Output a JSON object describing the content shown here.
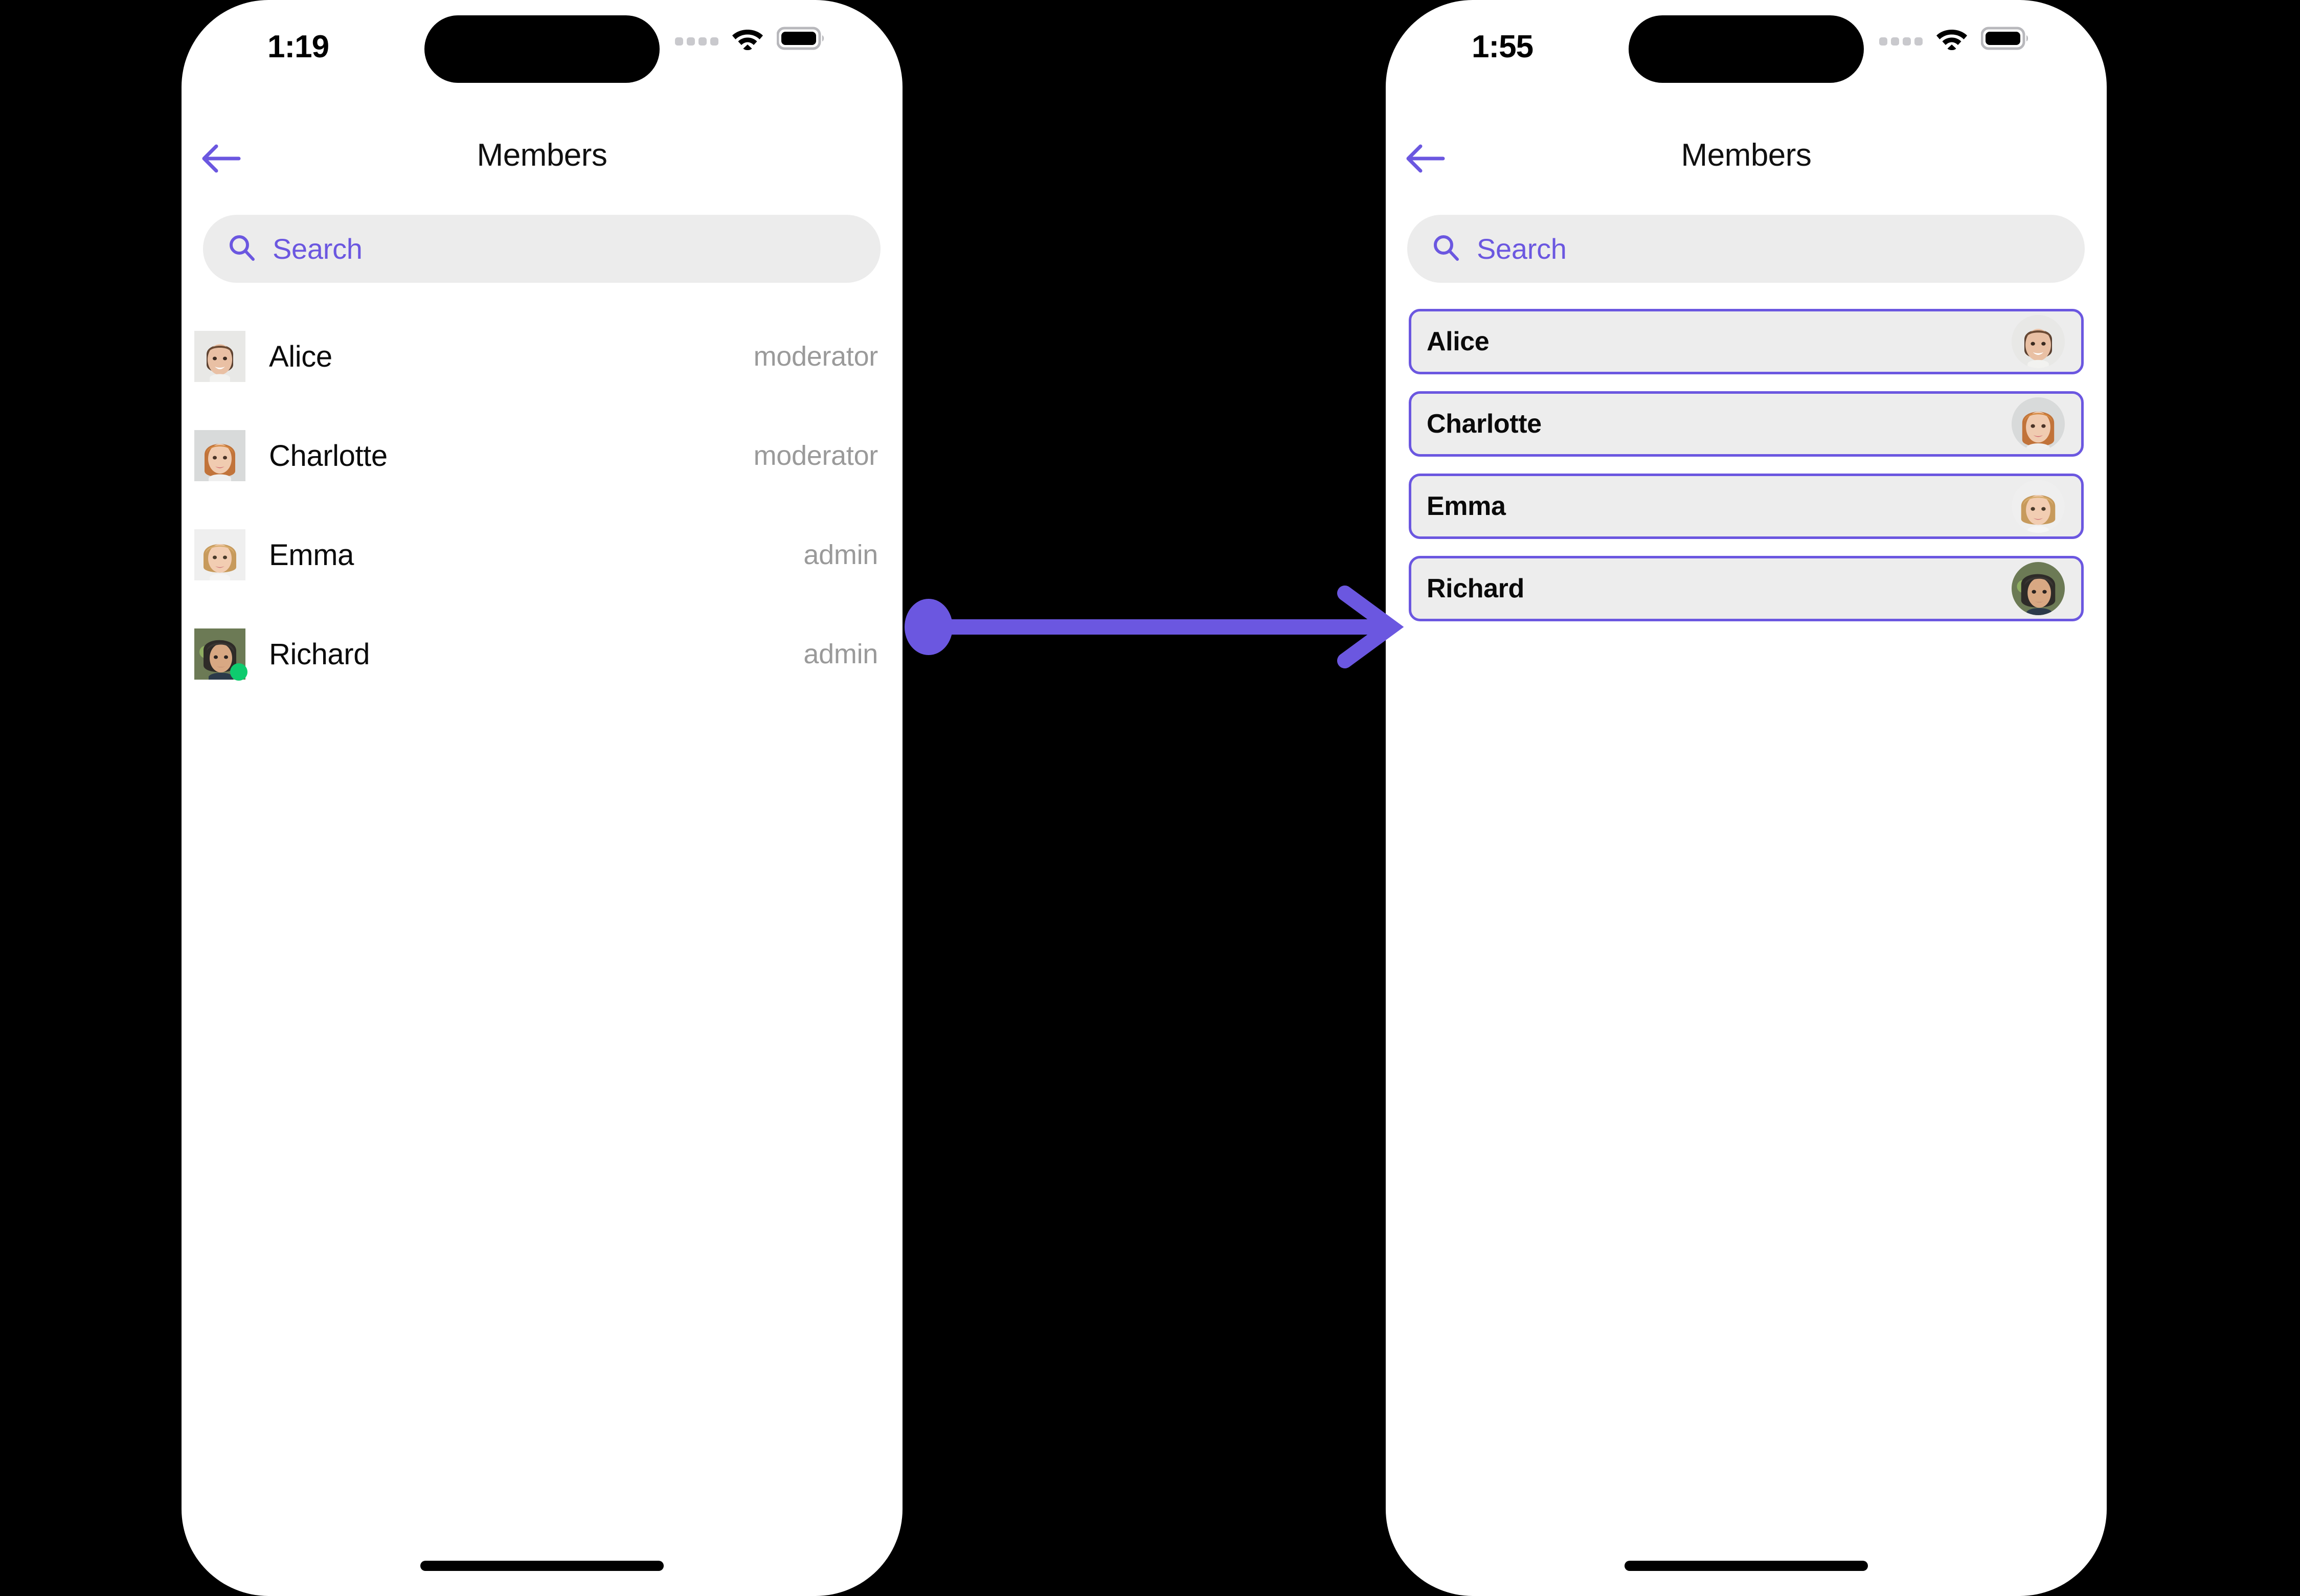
{
  "theme": {
    "accent": "#6b57e0",
    "card_fill": "#ededed",
    "search_fill": "#ececec",
    "role_text": "#9a9a9a",
    "online_badge": "#0ecb6e",
    "backdrop": "#000000"
  },
  "screens": [
    {
      "id": "members-list",
      "status_bar": {
        "time": "1:19",
        "cellular_icon": "cellular-bars-icon",
        "wifi_icon": "wifi-icon",
        "battery_icon": "battery-full-icon"
      },
      "nav": {
        "back_icon": "arrow-left-icon",
        "title": "Members"
      },
      "search": {
        "icon": "search-icon",
        "placeholder": "Search",
        "value": ""
      },
      "members": [
        {
          "name": "Alice",
          "role": "moderator",
          "online": false,
          "avatar": "avatar-alice"
        },
        {
          "name": "Charlotte",
          "role": "moderator",
          "online": false,
          "avatar": "avatar-charlotte"
        },
        {
          "name": "Emma",
          "role": "admin",
          "online": false,
          "avatar": "avatar-emma"
        },
        {
          "name": "Richard",
          "role": "admin",
          "online": true,
          "avatar": "avatar-richard"
        }
      ]
    },
    {
      "id": "members-select",
      "status_bar": {
        "time": "1:55",
        "cellular_icon": "cellular-bars-icon",
        "wifi_icon": "wifi-icon",
        "battery_icon": "battery-full-icon"
      },
      "nav": {
        "back_icon": "arrow-left-icon",
        "title": "Members"
      },
      "search": {
        "icon": "search-icon",
        "placeholder": "Search",
        "value": ""
      },
      "members": [
        {
          "name": "Alice",
          "selected": true,
          "avatar": "avatar-alice"
        },
        {
          "name": "Charlotte",
          "selected": true,
          "avatar": "avatar-charlotte"
        },
        {
          "name": "Emma",
          "selected": true,
          "avatar": "avatar-emma"
        },
        {
          "name": "Richard",
          "selected": true,
          "avatar": "avatar-richard"
        }
      ]
    }
  ],
  "annotation": {
    "type": "flow-arrow",
    "direction": "left-to-right",
    "from": "members-list.row.emma",
    "to": "members-select.card.emma",
    "color": "#6b57e0"
  }
}
